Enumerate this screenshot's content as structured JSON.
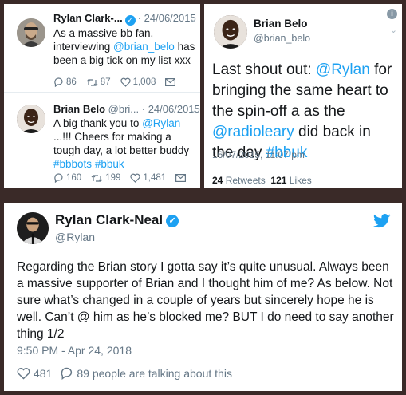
{
  "tweet_a": {
    "name": "Rylan Clark-...",
    "date": "· 24/06/2015",
    "text_prefix": "As a massive bb fan, interviewing ",
    "mention": "@brian_belo",
    "text_suffix": " has been a big tick on my list xxx",
    "replies": "86",
    "retweets": "87",
    "likes": "1,008"
  },
  "tweet_b": {
    "name": "Brian Belo",
    "handle": "@bri...",
    "date": "· 24/06/2015",
    "text_prefix": "A big thank you to ",
    "mention": "@Rylan",
    "text_middle": " ...!!! Cheers for making a tough day, a lot better buddy ",
    "hashtag1": "#bbbots",
    "hashtag2": "#bbuk",
    "replies": "160",
    "retweets": "199",
    "likes": "1,481"
  },
  "tweet_c": {
    "name": "Brian Belo",
    "handle": "@brian_belo",
    "text_prefix": "Last shout out: ",
    "mention1": "@Rylan",
    "text_middle": " for bringing the same heart to the spin-off a as the ",
    "mention2": "@radioleary",
    "text_middle2": " did back in the day ",
    "hashtag": "#bbuk",
    "date": "16/07/2015, 11:07 pm",
    "retweets_count": "24",
    "retweets_label": "Retweets",
    "likes_count": "121",
    "likes_label": "Likes"
  },
  "tweet_d": {
    "name": "Rylan Clark-Neal",
    "handle": "@Rylan",
    "text": "Regarding the Brian story I gotta say it’s quite unusual. Always been a massive supporter of Brian and I thought him of me? As below. Not sure what’s changed in a couple of years but sincerely hope he is well. Can’t @ him as he’s blocked me? BUT I do need to say another thing 1/2",
    "date": "9:50 PM - Apr 24, 2018",
    "likes": "481",
    "talking": "89 people are talking about this"
  },
  "icons": {
    "verified": "verified-badge-icon",
    "reply": "reply-icon",
    "retweet": "retweet-icon",
    "like": "heart-icon",
    "message": "envelope-icon",
    "bird": "twitter-bird-icon",
    "info": "info-icon",
    "chevron": "chevron-down-icon"
  },
  "colors": {
    "link": "#1da1f2",
    "muted": "#657786",
    "background_frame": "#3a2a28"
  }
}
